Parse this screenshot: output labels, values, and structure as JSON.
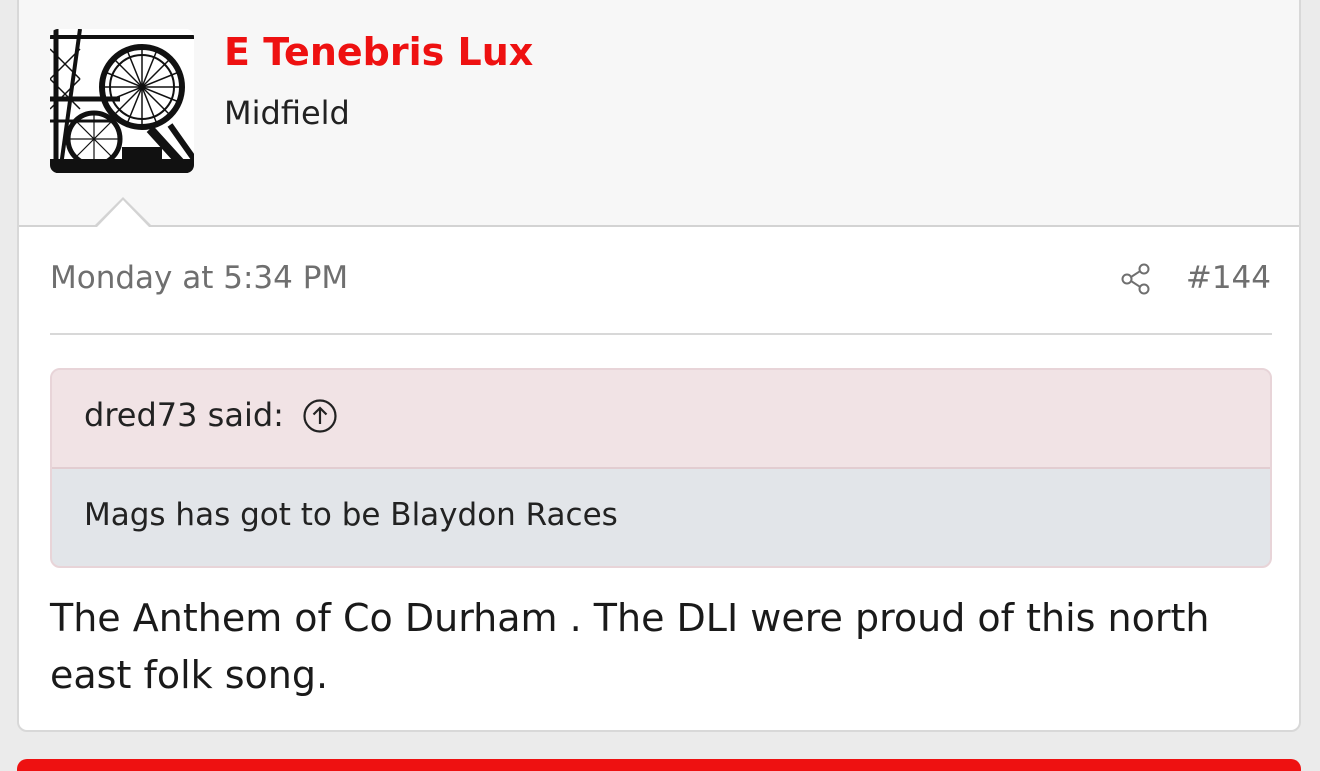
{
  "post": {
    "author": {
      "name": "E Tenebris Lux",
      "title": "Midfield",
      "avatar_icon": "winding-wheel-avatar"
    },
    "timestamp": "Monday at 5:34 PM",
    "share_icon": "share-icon",
    "number": "#144",
    "quote": {
      "attribution": "dred73 said:",
      "jump_icon": "arrow-up-circle-icon",
      "text": "Mags has got to be Blaydon Races"
    },
    "message": "The Anthem of Co Durham . The DLI were proud of this north east folk song."
  },
  "colors": {
    "accent": "#ee1111",
    "quote_header": "#f1e3e5",
    "quote_body": "#e2e5e9",
    "header_bg": "#f7f7f7"
  }
}
